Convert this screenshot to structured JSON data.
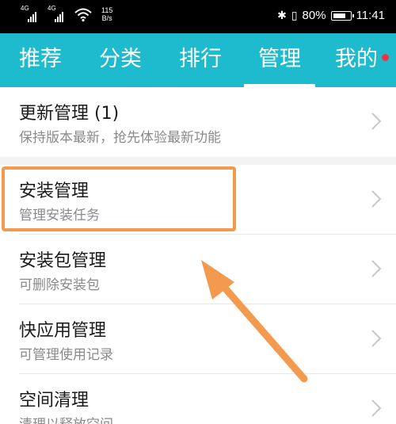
{
  "status_bar": {
    "signal1_label": "4G",
    "signal2_label": "4G",
    "speed_value": "115",
    "speed_unit": "B/s",
    "battery": "80%",
    "time": "11:41",
    "icons": [
      "signal-icon",
      "wifi-icon",
      "bluetooth-icon",
      "vibrate-icon",
      "battery-icon"
    ]
  },
  "tabs": [
    {
      "label": "推荐"
    },
    {
      "label": "分类"
    },
    {
      "label": "排行"
    },
    {
      "label": "管理",
      "active": true
    },
    {
      "label": "我的",
      "badge": true
    }
  ],
  "list": [
    {
      "title": "更新管理 (1)",
      "subtitle": "保持版本最新，抢先体验最新功能"
    },
    {
      "title": "安装管理",
      "subtitle": "管理安装任务"
    },
    {
      "title": "安装包管理",
      "subtitle": "可删除安装包"
    },
    {
      "title": "快应用管理",
      "subtitle": "可管理使用记录"
    },
    {
      "title": "空间清理",
      "subtitle": "清理以释放空间"
    }
  ],
  "colors": {
    "accent": "#1ebacd",
    "highlight": "#f39a4e",
    "badge": "#ee3344"
  }
}
